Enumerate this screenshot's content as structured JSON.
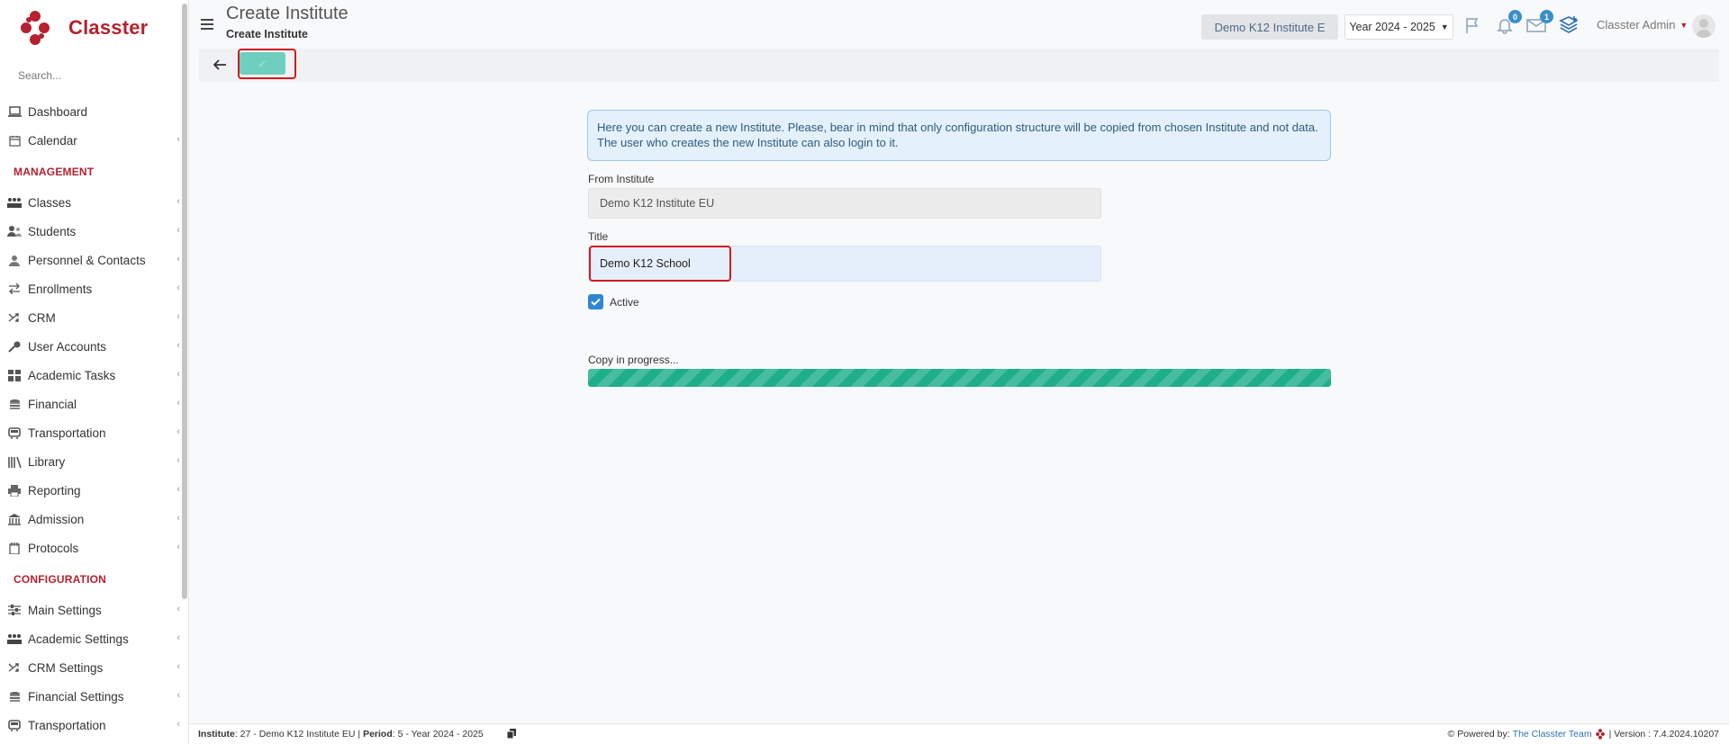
{
  "app": {
    "brand": "Classter",
    "brand_color": "#b5212e"
  },
  "sidebar": {
    "search_placeholder": "Search...",
    "items_top": [
      {
        "label": "Dashboard",
        "icon": "laptop-icon",
        "chevron": false
      },
      {
        "label": "Calendar",
        "icon": "calendar-icon",
        "chevron": true
      }
    ],
    "management_heading": "MANAGEMENT",
    "management_items": [
      {
        "label": "Classes",
        "icon": "classes-icon"
      },
      {
        "label": "Students",
        "icon": "students-icon"
      },
      {
        "label": "Personnel & Contacts",
        "icon": "personnel-icon"
      },
      {
        "label": "Enrollments",
        "icon": "enrollments-icon"
      },
      {
        "label": "CRM",
        "icon": "crm-icon"
      },
      {
        "label": "User Accounts",
        "icon": "key-icon"
      },
      {
        "label": "Academic Tasks",
        "icon": "grid-icon"
      },
      {
        "label": "Financial",
        "icon": "coins-icon"
      },
      {
        "label": "Transportation",
        "icon": "bus-icon"
      },
      {
        "label": "Library",
        "icon": "library-icon"
      },
      {
        "label": "Reporting",
        "icon": "printer-icon"
      },
      {
        "label": "Admission",
        "icon": "bank-icon"
      },
      {
        "label": "Protocols",
        "icon": "protocols-icon"
      }
    ],
    "configuration_heading": "CONFIGURATION",
    "configuration_items": [
      {
        "label": "Main Settings",
        "icon": "sliders-icon"
      },
      {
        "label": "Academic Settings",
        "icon": "classes-icon"
      },
      {
        "label": "CRM Settings",
        "icon": "crm-icon"
      },
      {
        "label": "Financial Settings",
        "icon": "coins-icon"
      },
      {
        "label": "Transportation",
        "icon": "bus-icon"
      }
    ]
  },
  "header": {
    "title": "Create Institute",
    "subtitle": "Create Institute",
    "institute_button": "Demo K12 Institute E",
    "year_select": "Year 2024 - 2025",
    "notifications_count": "0",
    "messages_count": "1",
    "user_name": "Classter Admin"
  },
  "form": {
    "info_text": "Here you can create a new Institute. Please, bear in mind that only configuration structure will be copied from chosen Institute and not data. The user who creates the new Institute can also login to it.",
    "from_label": "From Institute",
    "from_value": "Demo K12 Institute EU",
    "title_label": "Title",
    "title_value": "Demo K12 School",
    "active_label": "Active",
    "active_checked": true,
    "progress_label": "Copy in progress...",
    "progress_fraction": 1.0,
    "progress_color": "#1fae8a"
  },
  "footer": {
    "institute_key": "Institute",
    "institute_value": ": 27 - Demo K12 Institute EU |",
    "period_key": "Period",
    "period_value": ": 5 - Year 2024 - 2025",
    "powered_by": "Powered by:",
    "team_link": "The Classter Team",
    "version": "| Version : 7.4.2024.10207"
  }
}
